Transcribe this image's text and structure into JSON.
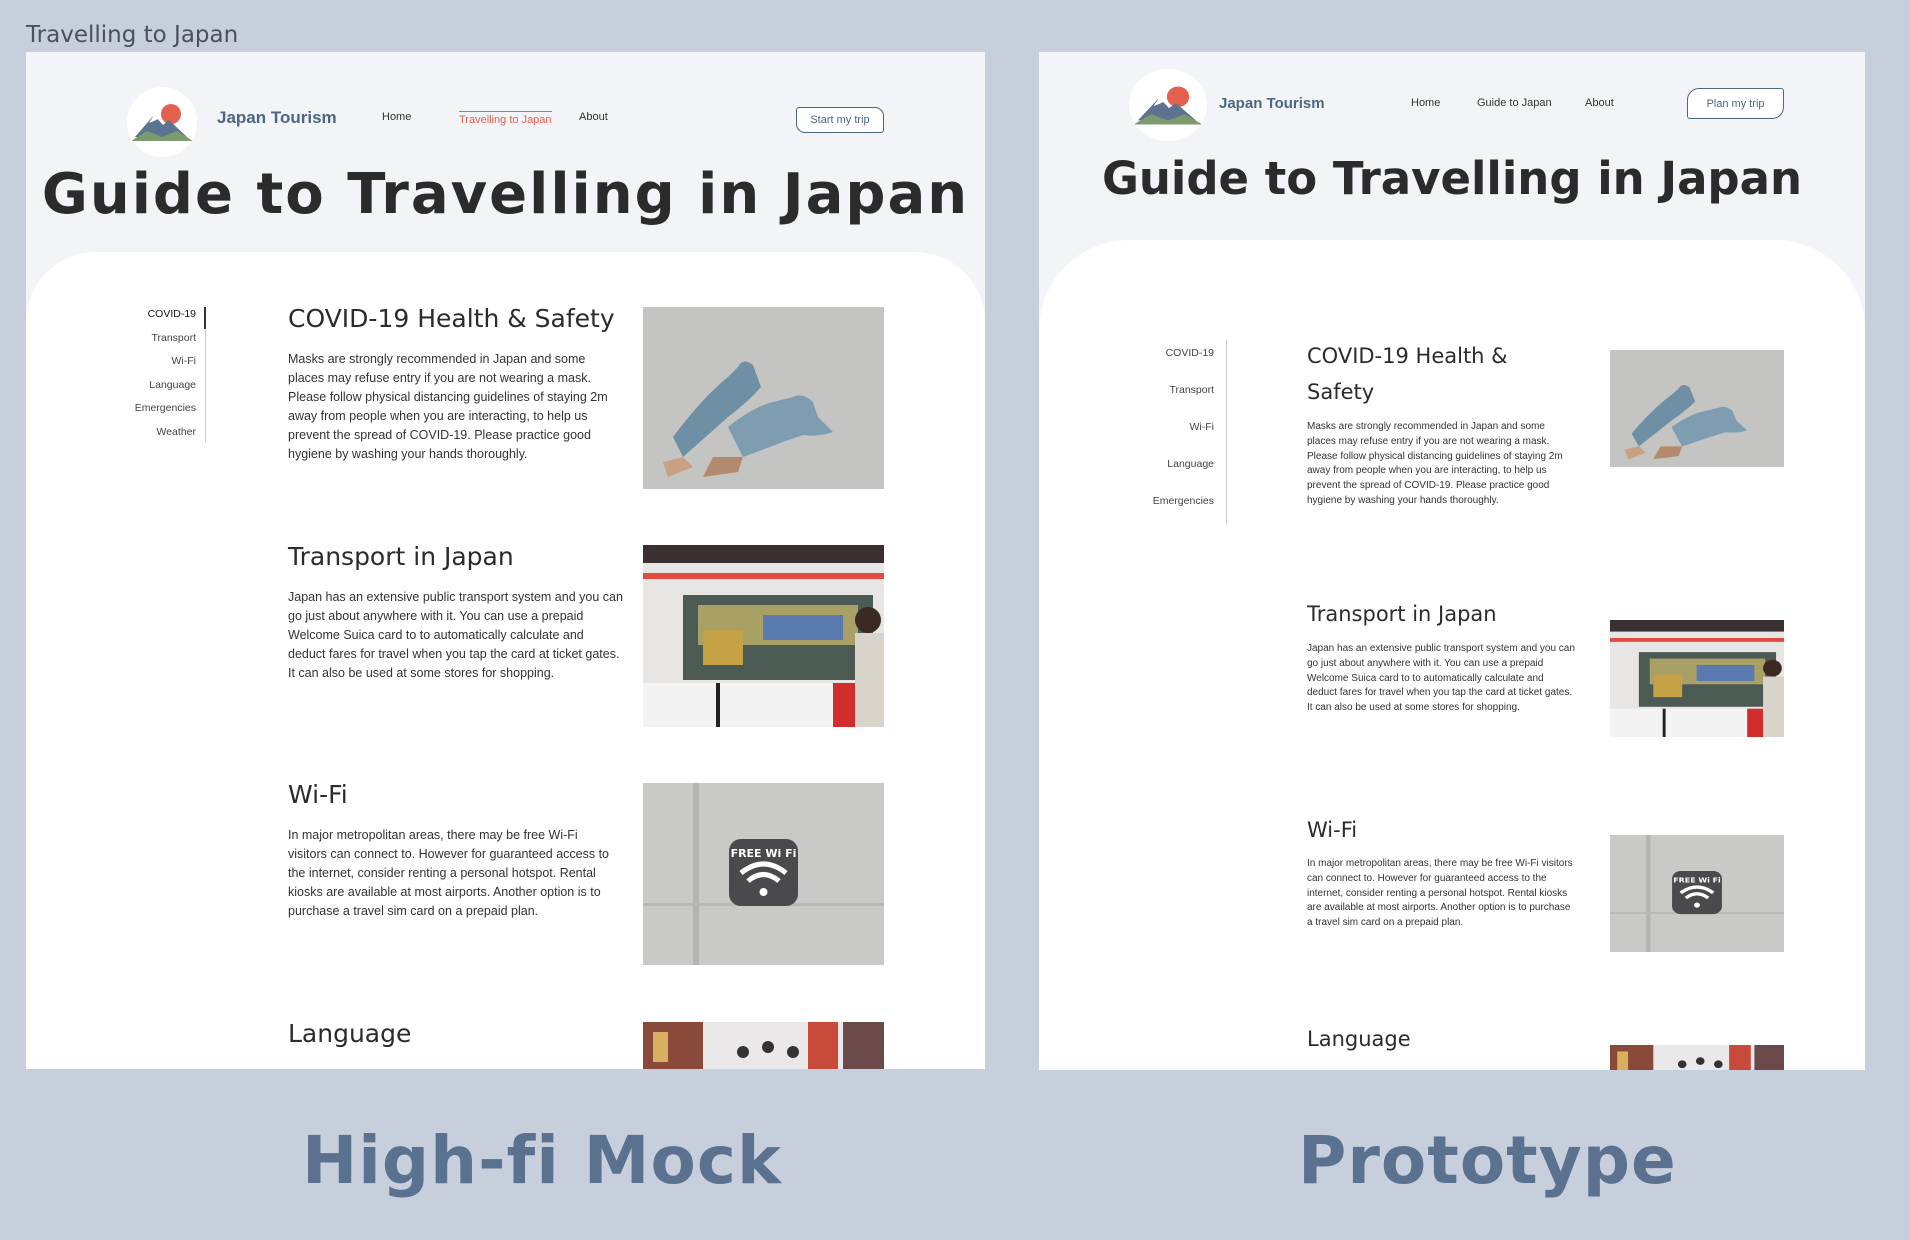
{
  "frame_label": "Travelling to Japan",
  "captions": {
    "mock": "High-fi Mock",
    "prototype": "Prototype"
  },
  "colors": {
    "background": "#c8cfdc",
    "brand": "#4f6584",
    "accent": "#e4604f",
    "panel": "#f2f4f8"
  },
  "mock": {
    "brand": "Japan Tourism",
    "nav": [
      "Home",
      "Travelling to Japan",
      "About"
    ],
    "active_nav": "Travelling to Japan",
    "cta": "Start my trip",
    "hero_title": "Guide to Travelling in Japan",
    "sidebar": [
      "COVID-19",
      "Transport",
      "Wi-Fi",
      "Language",
      "Emergencies",
      "Weather"
    ],
    "sections": [
      {
        "title": "COVID-19 Health & Safety",
        "text": "Masks are strongly recommended in Japan and some places may refuse entry if you are not wearing a mask. Please follow physical distancing guidelines of staying 2m away from people when you are interacting, to help us prevent the spread of COVID-19. Please practice good hygiene by washing your hands thoroughly.",
        "image": "gloves-photo"
      },
      {
        "title": "Transport in Japan",
        "text": "Japan has an extensive public transport system and you can go just about anywhere with it. You can use a prepaid Welcome Suica card to to automatically calculate and deduct fares for travel when you tap the card at ticket gates. It can also be used at some stores for shopping.",
        "image": "train-photo"
      },
      {
        "title": "Wi-Fi",
        "text": "In major metropolitan areas, there may be free Wi-Fi visitors can connect to. However for guaranteed access to the internet, consider renting a personal hotspot. Rental kiosks are available at most airports. Another option is to purchase a travel sim card on a prepaid plan.",
        "image": "wifi-sign-photo"
      },
      {
        "title": "Language",
        "text": "",
        "image": "street-photo"
      }
    ]
  },
  "prototype": {
    "brand": "Japan Tourism",
    "nav": [
      "Home",
      "Guide to Japan",
      "About"
    ],
    "cta": "Plan my trip",
    "hero_title": "Guide to Travelling in Japan",
    "sidebar": [
      "COVID-19",
      "Transport",
      "Wi-Fi",
      "Language",
      "Emergencies"
    ],
    "sections": [
      {
        "title": "COVID-19 Health & Safety",
        "text": "Masks are strongly recommended in Japan and some places may refuse entry if you are not wearing a mask. Please follow physical distancing guidelines of staying 2m away from people when you are interacting, to help us prevent the spread of COVID-19. Please practice good hygiene by washing your hands thoroughly.",
        "image": "gloves-photo"
      },
      {
        "title": "Transport in Japan",
        "text": "Japan has an extensive public transport system and you can go just about anywhere with it. You can use a prepaid Welcome Suica card to to automatically calculate and deduct fares for travel when you tap the card at ticket gates. It can also be used at some stores for shopping.",
        "image": "train-photo"
      },
      {
        "title": "Wi-Fi",
        "text": "In major metropolitan areas, there may be free Wi-Fi visitors can connect to. However for guaranteed access to the internet, consider renting a personal hotspot. Rental kiosks are available at most airports. Another option is to purchase a travel sim card on a prepaid plan.",
        "image": "wifi-sign-photo"
      },
      {
        "title": "Language",
        "text": "",
        "image": "street-photo"
      }
    ]
  },
  "wifi_sign_text": "FREE Wi Fi"
}
